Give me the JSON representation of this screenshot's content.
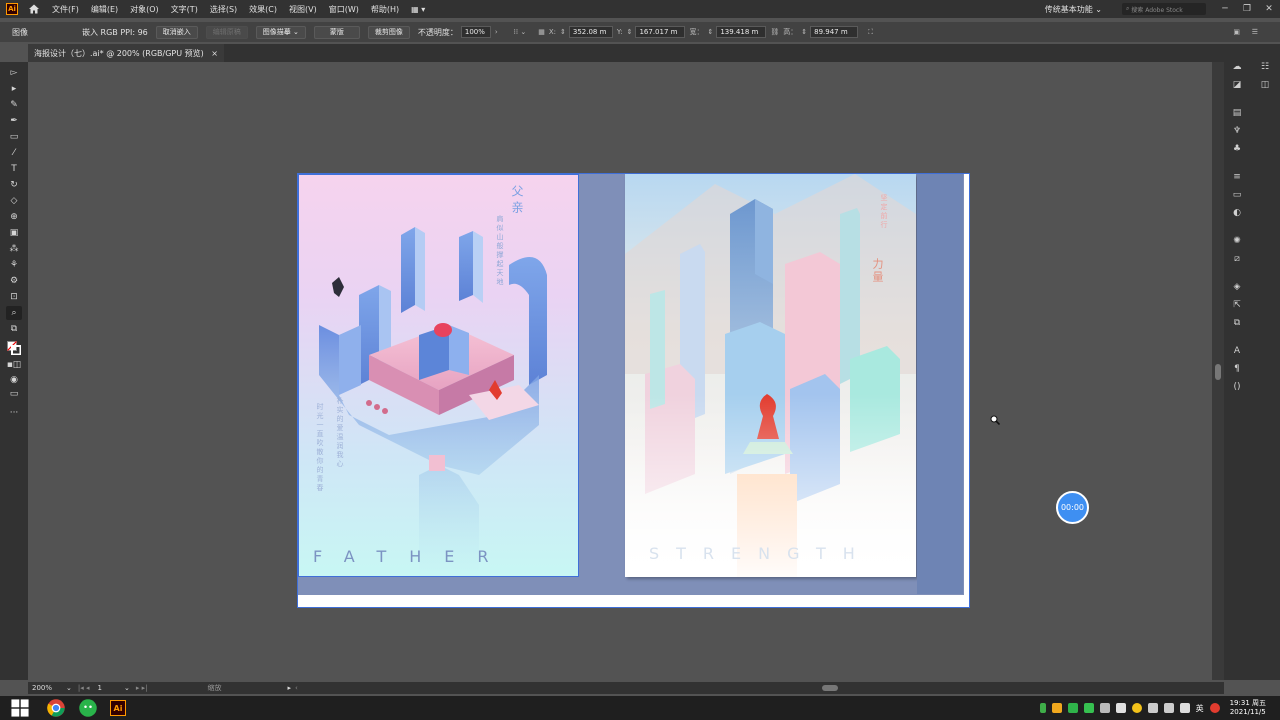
{
  "menubar": {
    "logo": "Ai",
    "items": [
      "文件(F)",
      "编辑(E)",
      "对象(O)",
      "文字(T)",
      "选择(S)",
      "效果(C)",
      "视图(V)",
      "窗口(W)",
      "帮助(H)"
    ],
    "workspace": "传统基本功能",
    "stock_placeholder": "搜索 Adobe Stock"
  },
  "controlbar": {
    "type_label": "图像",
    "embed_info": "嵌入  RGB  PPI: 96",
    "unembed": "取消嵌入",
    "edit_original": "编辑原稿",
    "image_trace": "图像描摹",
    "mask": "蒙版",
    "crop": "裁剪图像",
    "opacity_label": "不透明度：",
    "opacity": "100%",
    "x_label": "X:",
    "x": "352.08 m",
    "y_label": "Y:",
    "y": "167.017 m",
    "w_label": "宽：",
    "w": "139.418 m",
    "h_label": "高：",
    "h": "89.947 m"
  },
  "tab": {
    "title": "海报设计（七）.ai* @ 200% (RGB/GPU 预览)",
    "close": "×"
  },
  "poster_left": {
    "title_vertical": "父亲",
    "sub_vertical": "肩似山般撑起天地",
    "side_vertical_1": "朴实的爱温润我心",
    "side_vertical_2": "时光一直吹散你的青春",
    "word": "FATHER"
  },
  "poster_right": {
    "title_vertical": "力量",
    "sub_vertical": "坚定前行",
    "word": "STRENGTH"
  },
  "statusbar": {
    "zoom": "200%",
    "page": "1",
    "mode": "缩放"
  },
  "timer": "00:00",
  "taskbar": {
    "ime": "英",
    "time": "19:31 周五",
    "date": "2021/11/5"
  },
  "colors": {
    "accent": "#3f6fd8",
    "ui_dark": "#323232",
    "canvas": "#535353",
    "poster_red": "#e23c2f"
  }
}
